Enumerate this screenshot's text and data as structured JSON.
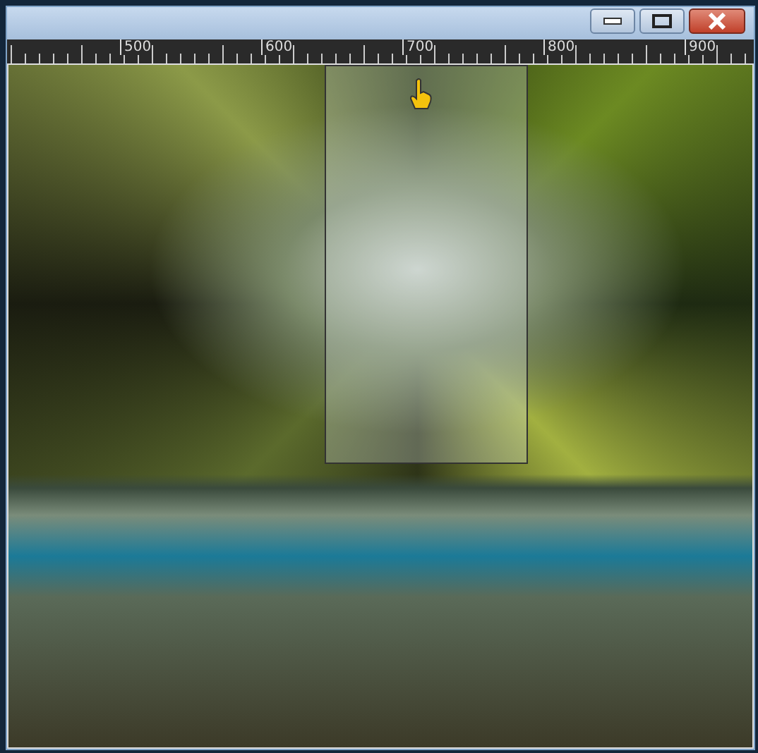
{
  "window": {
    "buttons": [
      {
        "kind": "minimize"
      },
      {
        "kind": "maximize"
      },
      {
        "kind": "close"
      }
    ]
  },
  "ruler": {
    "labels": [
      "500",
      "600",
      "700",
      "800",
      "900"
    ]
  }
}
